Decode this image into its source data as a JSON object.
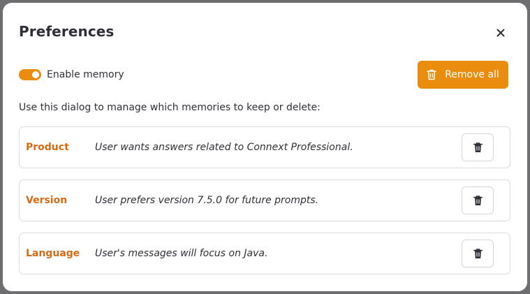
{
  "dialog": {
    "title": "Preferences",
    "close_icon": "close-icon"
  },
  "memory_toggle": {
    "label": "Enable memory",
    "enabled": true
  },
  "remove_all": {
    "label": "Remove all",
    "icon": "trash-icon"
  },
  "description": "Use this dialog to manage which memories to keep or delete:",
  "memories": [
    {
      "label": "Product",
      "text": "User wants answers related to Connext Professional."
    },
    {
      "label": "Version",
      "text": "User prefers version 7.5.0 for future prompts."
    },
    {
      "label": "Language",
      "text": "User's messages will focus on Java."
    }
  ],
  "colors": {
    "accent": "#ea8c0e",
    "label": "#d86a14",
    "text": "#2f2f38"
  }
}
